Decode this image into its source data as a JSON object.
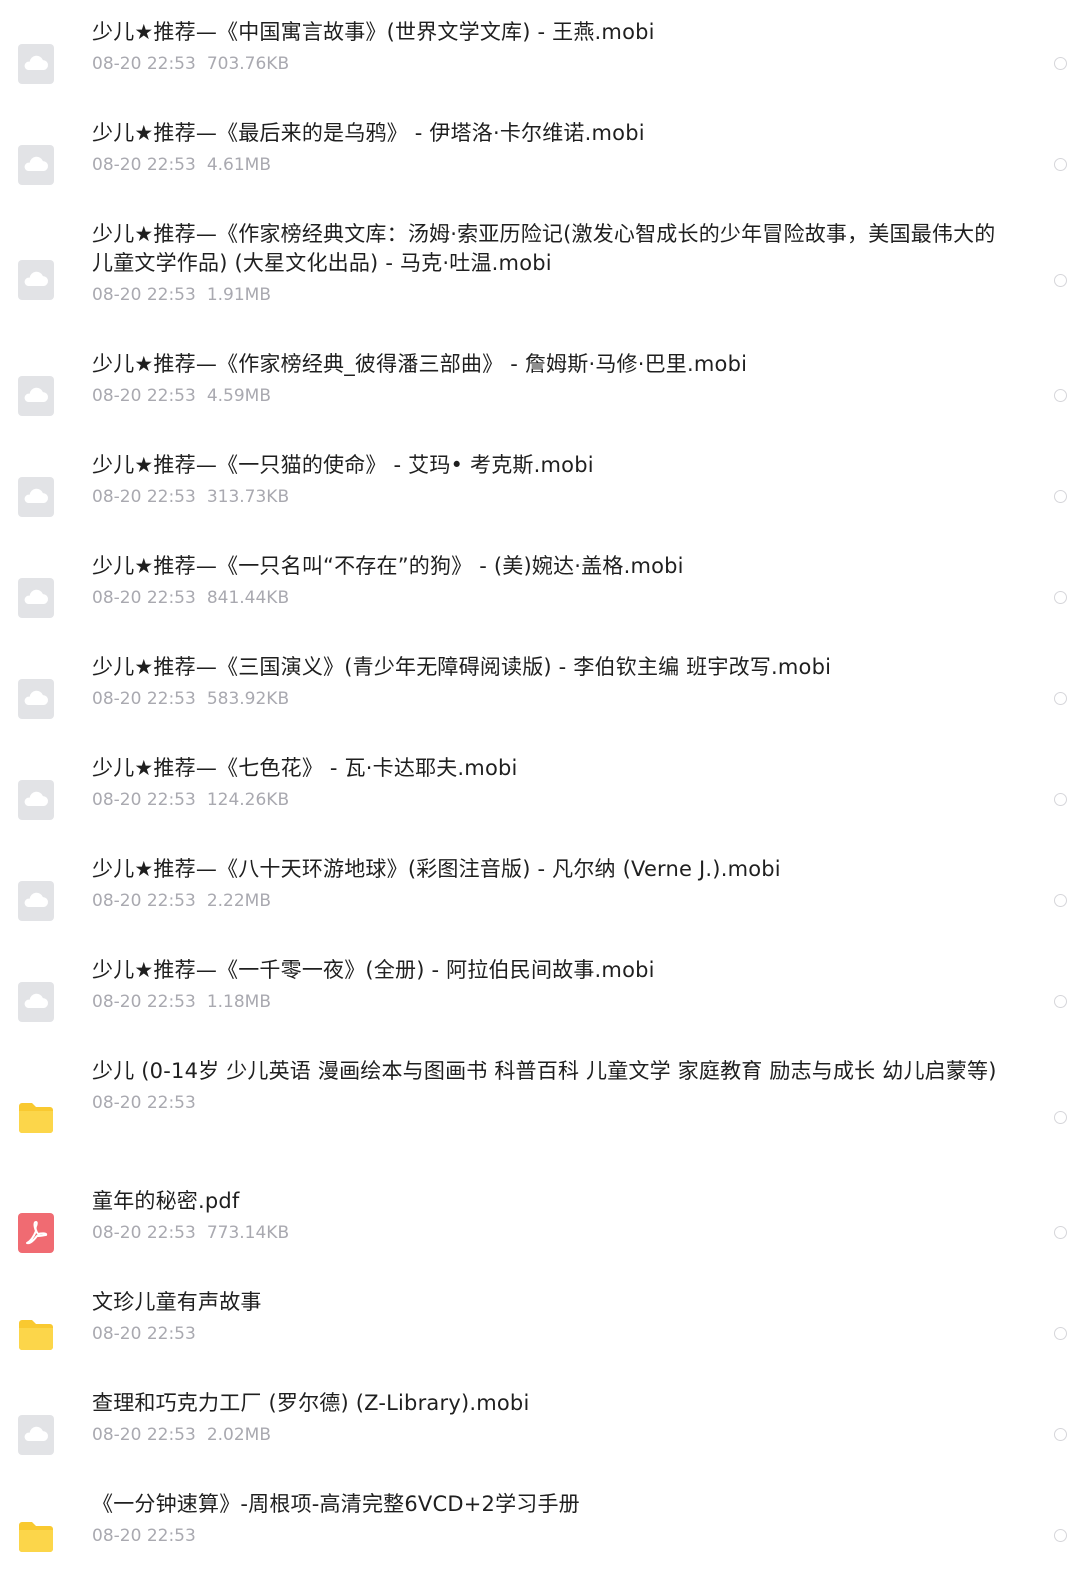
{
  "files": [
    {
      "type": "cloud",
      "name": "少儿★推荐—《中国寓言故事》(世界文学文库) - 王燕.mobi",
      "date": "08-20",
      "time": "22:53",
      "size": "703.76KB"
    },
    {
      "type": "cloud",
      "name": "少儿★推荐—《最后来的是乌鸦》 - 伊塔洛·卡尔维诺.mobi",
      "date": "08-20",
      "time": "22:53",
      "size": "4.61MB"
    },
    {
      "type": "cloud",
      "name": "少儿★推荐—《作家榜经典文库：汤姆·索亚历险记(激发心智成长的少年冒险故事，美国最伟大的儿童文学作品) (大星文化出品) - 马克·吐温.mobi",
      "date": "08-20",
      "time": "22:53",
      "size": "1.91MB"
    },
    {
      "type": "cloud",
      "name": "少儿★推荐—《作家榜经典_彼得潘三部曲》 - 詹姆斯·马修·巴里.mobi",
      "date": "08-20",
      "time": "22:53",
      "size": "4.59MB"
    },
    {
      "type": "cloud",
      "name": "少儿★推荐—《一只猫的使命》 - 艾玛• 考克斯.mobi",
      "date": "08-20",
      "time": "22:53",
      "size": "313.73KB"
    },
    {
      "type": "cloud",
      "name": "少儿★推荐—《一只名叫“不存在”的狗》 - (美)婉达·盖格.mobi",
      "date": "08-20",
      "time": "22:53",
      "size": "841.44KB"
    },
    {
      "type": "cloud",
      "name": "少儿★推荐—《三国演义》(青少年无障碍阅读版) - 李伯钦主编 班宇改写.mobi",
      "date": "08-20",
      "time": "22:53",
      "size": "583.92KB"
    },
    {
      "type": "cloud",
      "name": "少儿★推荐—《七色花》 - 瓦·卡达耶夫.mobi",
      "date": "08-20",
      "time": "22:53",
      "size": "124.26KB"
    },
    {
      "type": "cloud",
      "name": "少儿★推荐—《八十天环游地球》(彩图注音版) - 凡尔纳 (Verne J.).mobi",
      "date": "08-20",
      "time": "22:53",
      "size": "2.22MB"
    },
    {
      "type": "cloud",
      "name": "少儿★推荐—《一千零一夜》(全册) - 阿拉伯民间故事.mobi",
      "date": "08-20",
      "time": "22:53",
      "size": "1.18MB"
    },
    {
      "type": "folder",
      "name": "少儿 (0-14岁 少儿英语 漫画绘本与图画书 科普百科 儿童文学 家庭教育 励志与成长 幼儿启蒙等)",
      "date": "08-20",
      "time": "22:53",
      "size": ""
    },
    {
      "type": "pdf",
      "name": "童年的秘密.pdf",
      "date": "08-20",
      "time": "22:53",
      "size": "773.14KB"
    },
    {
      "type": "folder",
      "name": "文珍儿童有声故事",
      "date": "08-20",
      "time": "22:53",
      "size": ""
    },
    {
      "type": "cloud",
      "name": "查理和巧克力工厂 (罗尔德) (Z-Library).mobi",
      "date": "08-20",
      "time": "22:53",
      "size": "2.02MB"
    },
    {
      "type": "folder",
      "name": "《一分钟速算》-周根项-高清完整6VCD+2学习手册",
      "date": "08-20",
      "time": "22:53",
      "size": ""
    }
  ]
}
